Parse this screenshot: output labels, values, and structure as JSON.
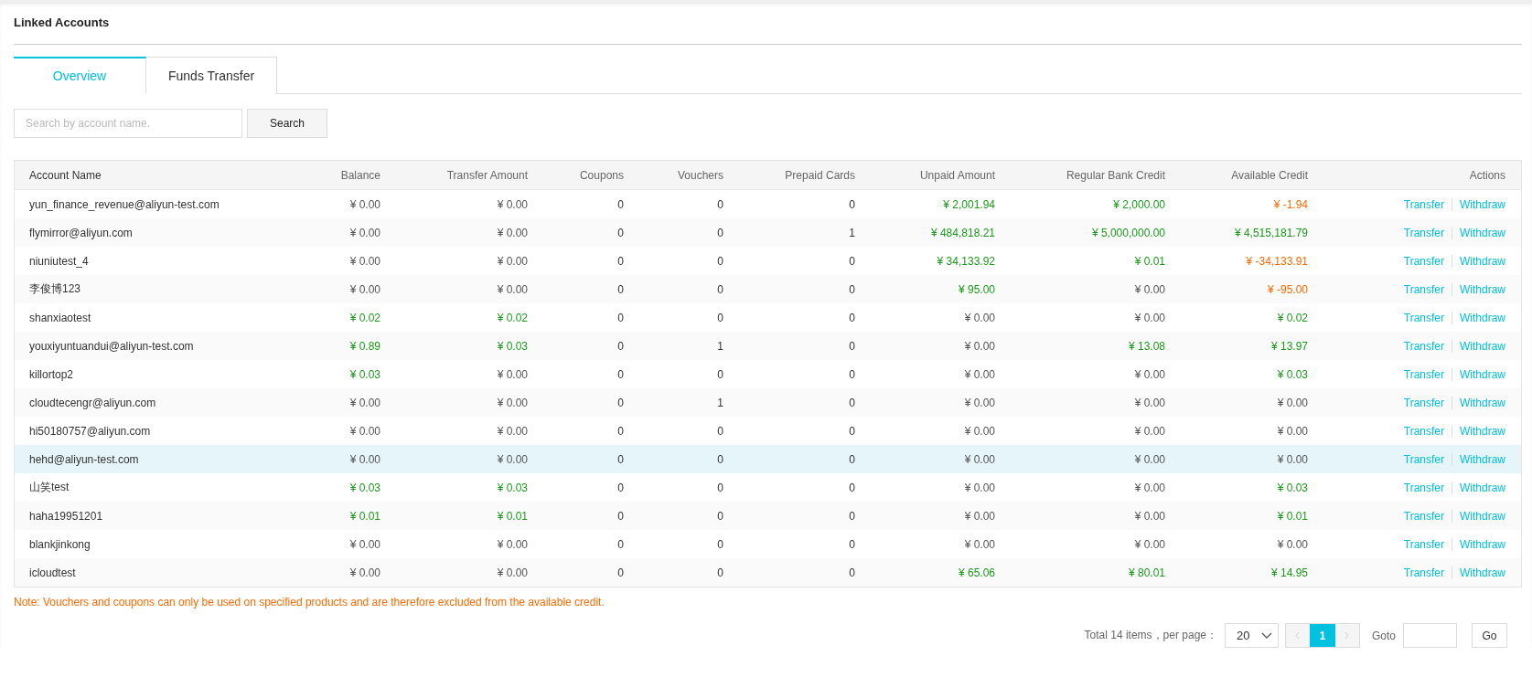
{
  "page": {
    "title": "Linked Accounts"
  },
  "tabs": [
    {
      "label": "Overview",
      "selected": true
    },
    {
      "label": "Funds Transfer",
      "selected": false
    }
  ],
  "search": {
    "placeholder": "Search by account name.",
    "button": "Search"
  },
  "table": {
    "columns": [
      "Account Name",
      "Balance",
      "Transfer Amount",
      "Coupons",
      "Vouchers",
      "Prepaid Cards",
      "Unpaid Amount",
      "Regular Bank Credit",
      "Available Credit",
      "Actions"
    ],
    "rows": [
      {
        "highlighted": false,
        "account": "yun_finance_revenue@aliyun-test.com",
        "balance": {
          "text": "¥ 0.00",
          "color": "#555555"
        },
        "transfer_amount": {
          "text": "¥ 0.00",
          "color": "#555555"
        },
        "coupons": "0",
        "vouchers": "0",
        "prepaid_cards": "0",
        "unpaid_amount": {
          "text": "¥ 2,001.94",
          "color": "#1a9a1a"
        },
        "regular_bank_credit": {
          "text": "¥ 2,000.00",
          "color": "#1a9a1a"
        },
        "available_credit": {
          "text": "¥ -1.94",
          "color": "#ff6a00"
        },
        "actions": [
          "Transfer",
          "Withdraw"
        ]
      },
      {
        "highlighted": false,
        "account": "flymirror@aliyun.com",
        "balance": {
          "text": "¥ 0.00",
          "color": "#555555"
        },
        "transfer_amount": {
          "text": "¥ 0.00",
          "color": "#555555"
        },
        "coupons": "0",
        "vouchers": "0",
        "prepaid_cards": "1",
        "unpaid_amount": {
          "text": "¥ 484,818.21",
          "color": "#1a9a1a"
        },
        "regular_bank_credit": {
          "text": "¥ 5,000,000.00",
          "color": "#1a9a1a"
        },
        "available_credit": {
          "text": "¥ 4,515,181.79",
          "color": "#1a9a1a"
        },
        "actions": [
          "Transfer",
          "Withdraw"
        ]
      },
      {
        "highlighted": false,
        "account": "niuniutest_4",
        "balance": {
          "text": "¥ 0.00",
          "color": "#555555"
        },
        "transfer_amount": {
          "text": "¥ 0.00",
          "color": "#555555"
        },
        "coupons": "0",
        "vouchers": "0",
        "prepaid_cards": "0",
        "unpaid_amount": {
          "text": "¥ 34,133.92",
          "color": "#1a9a1a"
        },
        "regular_bank_credit": {
          "text": "¥ 0.01",
          "color": "#1a9a1a"
        },
        "available_credit": {
          "text": "¥ -34,133.91",
          "color": "#ff6a00"
        },
        "actions": [
          "Transfer",
          "Withdraw"
        ]
      },
      {
        "highlighted": false,
        "account": "李俊博123",
        "balance": {
          "text": "¥ 0.00",
          "color": "#555555"
        },
        "transfer_amount": {
          "text": "¥ 0.00",
          "color": "#555555"
        },
        "coupons": "0",
        "vouchers": "0",
        "prepaid_cards": "0",
        "unpaid_amount": {
          "text": "¥ 95.00",
          "color": "#1a9a1a"
        },
        "regular_bank_credit": {
          "text": "¥ 0.00",
          "color": "#555555"
        },
        "available_credit": {
          "text": "¥ -95.00",
          "color": "#ff6a00"
        },
        "actions": [
          "Transfer",
          "Withdraw"
        ]
      },
      {
        "highlighted": false,
        "account": "shanxiaotest",
        "balance": {
          "text": "¥ 0.02",
          "color": "#1a9a1a"
        },
        "transfer_amount": {
          "text": "¥ 0.02",
          "color": "#1a9a1a"
        },
        "coupons": "0",
        "vouchers": "0",
        "prepaid_cards": "0",
        "unpaid_amount": {
          "text": "¥ 0.00",
          "color": "#555555"
        },
        "regular_bank_credit": {
          "text": "¥ 0.00",
          "color": "#555555"
        },
        "available_credit": {
          "text": "¥ 0.02",
          "color": "#1a9a1a"
        },
        "actions": [
          "Transfer",
          "Withdraw"
        ]
      },
      {
        "highlighted": false,
        "account": "youxiyuntuandui@aliyun-test.com",
        "balance": {
          "text": "¥ 0.89",
          "color": "#1a9a1a"
        },
        "transfer_amount": {
          "text": "¥ 0.03",
          "color": "#1a9a1a"
        },
        "coupons": "0",
        "vouchers": "1",
        "prepaid_cards": "0",
        "unpaid_amount": {
          "text": "¥ 0.00",
          "color": "#555555"
        },
        "regular_bank_credit": {
          "text": "¥ 13.08",
          "color": "#1a9a1a"
        },
        "available_credit": {
          "text": "¥ 13.97",
          "color": "#1a9a1a"
        },
        "actions": [
          "Transfer",
          "Withdraw"
        ]
      },
      {
        "highlighted": false,
        "account": "killortop2",
        "balance": {
          "text": "¥ 0.03",
          "color": "#1a9a1a"
        },
        "transfer_amount": {
          "text": "¥ 0.00",
          "color": "#555555"
        },
        "coupons": "0",
        "vouchers": "0",
        "prepaid_cards": "0",
        "unpaid_amount": {
          "text": "¥ 0.00",
          "color": "#555555"
        },
        "regular_bank_credit": {
          "text": "¥ 0.00",
          "color": "#555555"
        },
        "available_credit": {
          "text": "¥ 0.03",
          "color": "#1a9a1a"
        },
        "actions": [
          "Transfer",
          "Withdraw"
        ]
      },
      {
        "highlighted": false,
        "account": "cloudtecengr@aliyun.com",
        "balance": {
          "text": "¥ 0.00",
          "color": "#555555"
        },
        "transfer_amount": {
          "text": "¥ 0.00",
          "color": "#555555"
        },
        "coupons": "0",
        "vouchers": "1",
        "prepaid_cards": "0",
        "unpaid_amount": {
          "text": "¥ 0.00",
          "color": "#555555"
        },
        "regular_bank_credit": {
          "text": "¥ 0.00",
          "color": "#555555"
        },
        "available_credit": {
          "text": "¥ 0.00",
          "color": "#555555"
        },
        "actions": [
          "Transfer",
          "Withdraw"
        ]
      },
      {
        "highlighted": false,
        "account": "hi50180757@aliyun.com",
        "balance": {
          "text": "¥ 0.00",
          "color": "#555555"
        },
        "transfer_amount": {
          "text": "¥ 0.00",
          "color": "#555555"
        },
        "coupons": "0",
        "vouchers": "0",
        "prepaid_cards": "0",
        "unpaid_amount": {
          "text": "¥ 0.00",
          "color": "#555555"
        },
        "regular_bank_credit": {
          "text": "¥ 0.00",
          "color": "#555555"
        },
        "available_credit": {
          "text": "¥ 0.00",
          "color": "#555555"
        },
        "actions": [
          "Transfer",
          "Withdraw"
        ]
      },
      {
        "highlighted": true,
        "account": "hehd@aliyun-test.com",
        "balance": {
          "text": "¥ 0.00",
          "color": "#555555"
        },
        "transfer_amount": {
          "text": "¥ 0.00",
          "color": "#555555"
        },
        "coupons": "0",
        "vouchers": "0",
        "prepaid_cards": "0",
        "unpaid_amount": {
          "text": "¥ 0.00",
          "color": "#555555"
        },
        "regular_bank_credit": {
          "text": "¥ 0.00",
          "color": "#555555"
        },
        "available_credit": {
          "text": "¥ 0.00",
          "color": "#555555"
        },
        "actions": [
          "Transfer",
          "Withdraw"
        ]
      },
      {
        "highlighted": false,
        "account": "山笑test",
        "balance": {
          "text": "¥ 0.03",
          "color": "#1a9a1a"
        },
        "transfer_amount": {
          "text": "¥ 0.03",
          "color": "#1a9a1a"
        },
        "coupons": "0",
        "vouchers": "0",
        "prepaid_cards": "0",
        "unpaid_amount": {
          "text": "¥ 0.00",
          "color": "#555555"
        },
        "regular_bank_credit": {
          "text": "¥ 0.00",
          "color": "#555555"
        },
        "available_credit": {
          "text": "¥ 0.03",
          "color": "#1a9a1a"
        },
        "actions": [
          "Transfer",
          "Withdraw"
        ]
      },
      {
        "highlighted": false,
        "account": "haha19951201",
        "balance": {
          "text": "¥ 0.01",
          "color": "#1a9a1a"
        },
        "transfer_amount": {
          "text": "¥ 0.01",
          "color": "#1a9a1a"
        },
        "coupons": "0",
        "vouchers": "0",
        "prepaid_cards": "0",
        "unpaid_amount": {
          "text": "¥ 0.00",
          "color": "#555555"
        },
        "regular_bank_credit": {
          "text": "¥ 0.00",
          "color": "#555555"
        },
        "available_credit": {
          "text": "¥ 0.01",
          "color": "#1a9a1a"
        },
        "actions": [
          "Transfer",
          "Withdraw"
        ]
      },
      {
        "highlighted": false,
        "account": "blankjinkong",
        "balance": {
          "text": "¥ 0.00",
          "color": "#555555"
        },
        "transfer_amount": {
          "text": "¥ 0.00",
          "color": "#555555"
        },
        "coupons": "0",
        "vouchers": "0",
        "prepaid_cards": "0",
        "unpaid_amount": {
          "text": "¥ 0.00",
          "color": "#555555"
        },
        "regular_bank_credit": {
          "text": "¥ 0.00",
          "color": "#555555"
        },
        "available_credit": {
          "text": "¥ 0.00",
          "color": "#555555"
        },
        "actions": [
          "Transfer",
          "Withdraw"
        ]
      },
      {
        "highlighted": false,
        "account": "icloudtest",
        "balance": {
          "text": "¥ 0.00",
          "color": "#555555"
        },
        "transfer_amount": {
          "text": "¥ 0.00",
          "color": "#555555"
        },
        "coupons": "0",
        "vouchers": "0",
        "prepaid_cards": "0",
        "unpaid_amount": {
          "text": "¥ 65.06",
          "color": "#1a9a1a"
        },
        "regular_bank_credit": {
          "text": "¥ 80.01",
          "color": "#1a9a1a"
        },
        "available_credit": {
          "text": "¥ 14.95",
          "color": "#1a9a1a"
        },
        "actions": [
          "Transfer",
          "Withdraw"
        ]
      }
    ]
  },
  "note": "Note: Vouchers and coupons can only be used on specified products and are therefore excluded from the available credit.",
  "pagination": {
    "summary": "Total 14 items，per page：",
    "page_size": "20",
    "pages": [
      {
        "label": "1",
        "selected": true
      }
    ],
    "goto_label": "Goto",
    "go_button": "Go"
  }
}
